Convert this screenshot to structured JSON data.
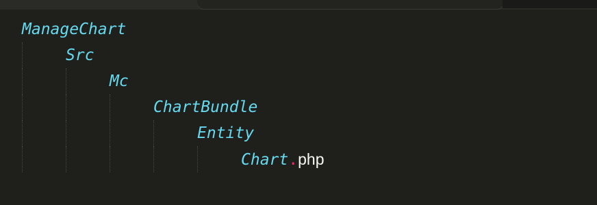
{
  "tree": [
    {
      "name": "ManageChart"
    },
    {
      "name": "Src"
    },
    {
      "name": "Mc"
    },
    {
      "name": "ChartBundle"
    },
    {
      "name": "Entity"
    },
    {
      "name": "Chart",
      "separator": ".",
      "extension": "php"
    }
  ],
  "colors": {
    "background": "#1f201c",
    "namespace_text": "#66d9ef",
    "separator": "#f92672",
    "extension_text": "#f8f8f2",
    "indent_guide": "#4a4b45"
  }
}
